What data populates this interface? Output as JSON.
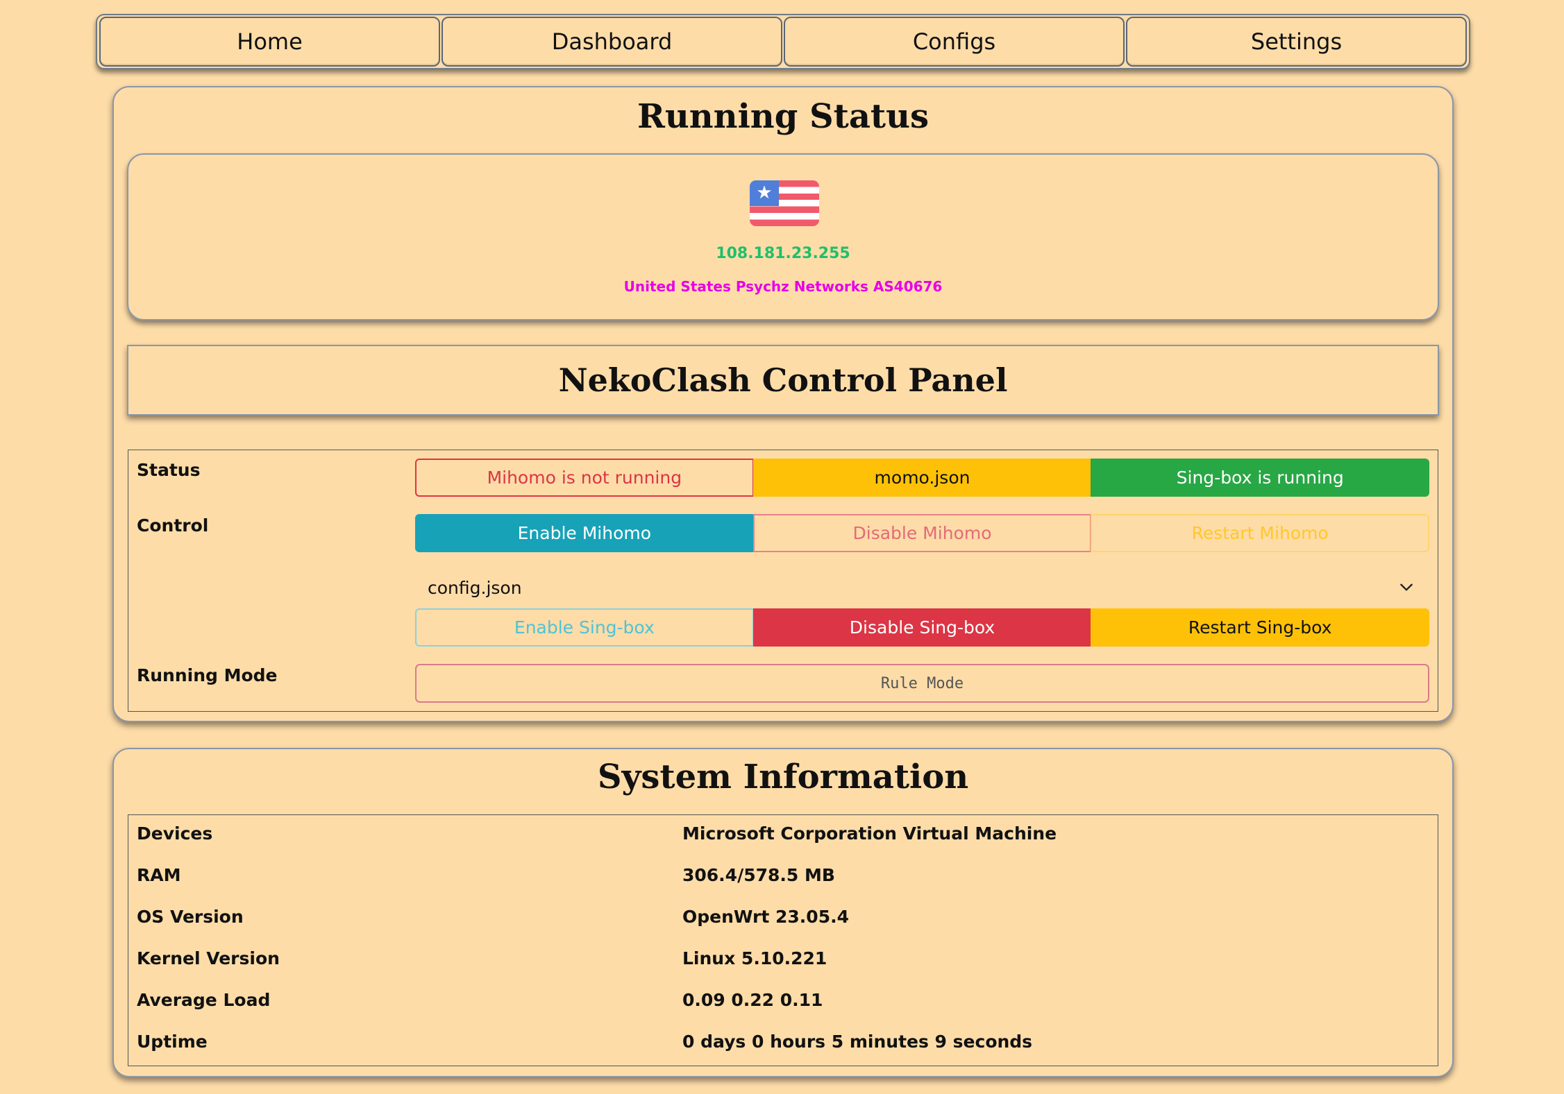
{
  "nav": {
    "items": [
      "Home",
      "Dashboard",
      "Configs",
      "Settings"
    ]
  },
  "running_status": {
    "title": "Running Status",
    "flag_icon": "us-flag-icon",
    "ip": "108.181.23.255",
    "location": "United States Psychz Networks AS40676",
    "colors": {
      "ip": "#1fbf6a",
      "location": "#e600e6"
    }
  },
  "control_panel": {
    "title": "NekoClash Control Panel",
    "status_label": "Status",
    "status": {
      "mihomo": "Mihomo is not running",
      "config": "momo.json",
      "singbox": "Sing-box is running"
    },
    "control_label": "Control",
    "mihomo_buttons": {
      "enable": "Enable Mihomo",
      "disable": "Disable Mihomo",
      "restart": "Restart Mihomo"
    },
    "config_select": {
      "value": "config.json",
      "options": [
        "config.json"
      ]
    },
    "singbox_buttons": {
      "enable": "Enable Sing-box",
      "disable": "Disable Sing-box",
      "restart": "Restart Sing-box"
    },
    "running_mode_label": "Running Mode",
    "running_mode_value": "Rule Mode"
  },
  "system_info": {
    "title": "System Information",
    "rows": [
      {
        "key": "Devices",
        "value": "Microsoft Corporation Virtual Machine"
      },
      {
        "key": "RAM",
        "value": "306.4/578.5 MB"
      },
      {
        "key": "OS Version",
        "value": "OpenWrt 23.05.4"
      },
      {
        "key": "Kernel Version",
        "value": "Linux 5.10.221"
      },
      {
        "key": "Average Load",
        "value": "0.09 0.22 0.11"
      },
      {
        "key": "Uptime",
        "value": "0 days 0 hours 5 minutes 9 seconds"
      }
    ]
  },
  "colors": {
    "background": "#fddca8",
    "danger": "#dc3545",
    "warning": "#ffc107",
    "success": "#28a745",
    "info": "#17a2b8"
  }
}
